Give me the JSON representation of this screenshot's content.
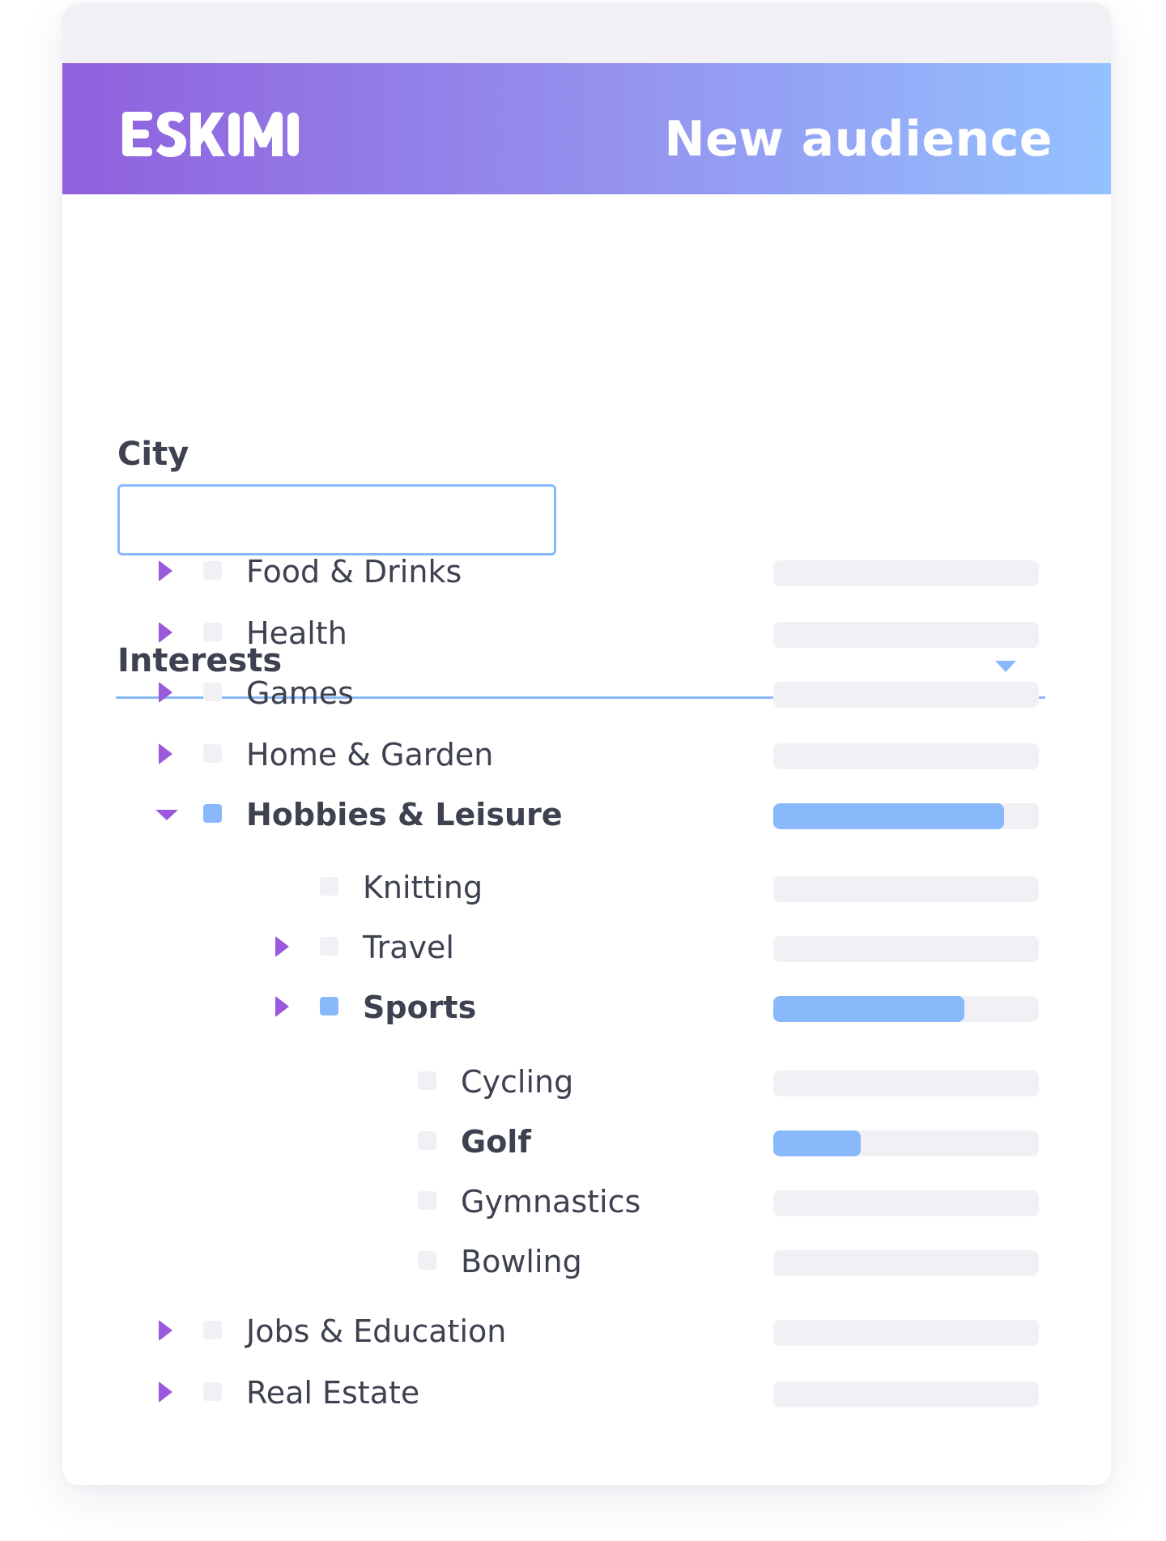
{
  "header": {
    "logo_text": "ESKIMI",
    "title": "New audience"
  },
  "city": {
    "label": "City",
    "value": "",
    "placeholder": ""
  },
  "interests": {
    "label": "Interests",
    "items": [
      {
        "label": "Food & Drinks",
        "level": 0,
        "toggle": "collapsed",
        "checked": false,
        "bold": false,
        "fill": 0
      },
      {
        "label": "Health",
        "level": 0,
        "toggle": "collapsed",
        "checked": false,
        "bold": false,
        "fill": 0
      },
      {
        "label": "Games",
        "level": 0,
        "toggle": "collapsed",
        "checked": false,
        "bold": false,
        "fill": 0
      },
      {
        "label": "Home & Garden",
        "level": 0,
        "toggle": "collapsed",
        "checked": false,
        "bold": false,
        "fill": 0
      },
      {
        "label": "Hobbies & Leisure",
        "level": 0,
        "toggle": "expanded",
        "checked": true,
        "bold": true,
        "fill": 0.87
      },
      {
        "label": "Knitting",
        "level": 1,
        "toggle": "none",
        "checked": false,
        "bold": false,
        "fill": 0
      },
      {
        "label": "Travel",
        "level": 1,
        "toggle": "collapsed",
        "checked": false,
        "bold": false,
        "fill": 0
      },
      {
        "label": "Sports",
        "level": 1,
        "toggle": "collapsed",
        "checked": true,
        "bold": true,
        "fill": 0.72
      },
      {
        "label": "Cycling",
        "level": 2,
        "toggle": "none",
        "checked": false,
        "bold": false,
        "fill": 0
      },
      {
        "label": "Golf",
        "level": 2,
        "toggle": "none",
        "checked": false,
        "bold": true,
        "fill": 0.33
      },
      {
        "label": "Gymnastics",
        "level": 2,
        "toggle": "none",
        "checked": false,
        "bold": false,
        "fill": 0
      },
      {
        "label": "Bowling",
        "level": 2,
        "toggle": "none",
        "checked": false,
        "bold": false,
        "fill": 0
      },
      {
        "label": "Jobs & Education",
        "level": 0,
        "toggle": "collapsed",
        "checked": false,
        "bold": false,
        "fill": 0
      },
      {
        "label": "Real Estate",
        "level": 0,
        "toggle": "collapsed",
        "checked": false,
        "bold": false,
        "fill": 0
      }
    ]
  },
  "colors": {
    "gradient_start": "#9060dd",
    "gradient_end": "#94c1ff",
    "accent_blue": "#8ab9fb",
    "accent_purple": "#9a59db",
    "text": "#3d4150",
    "muted": "#f1f1f5"
  },
  "icons": {
    "collapsed": "caret-right-icon",
    "expanded": "caret-down-icon",
    "select": "chevron-down-icon"
  }
}
